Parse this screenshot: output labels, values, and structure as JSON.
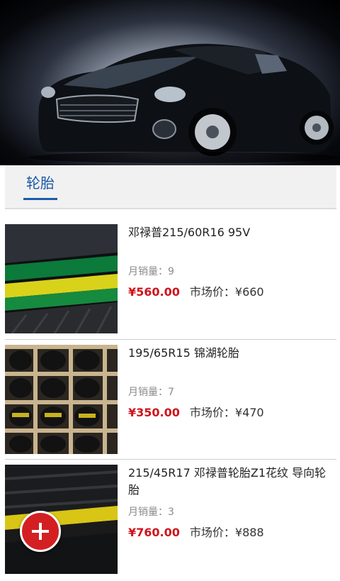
{
  "banner": {
    "image": "sports-car-photo"
  },
  "tabs": [
    {
      "label": "轮胎",
      "active": true
    }
  ],
  "products": [
    {
      "title": "邓禄普215/60R16 95V",
      "sales_label": "月销量：",
      "sales_count": "9",
      "price": "¥560.00",
      "market_label": "市场价：",
      "market_price": "¥660",
      "image": "dunlop-tire-photo"
    },
    {
      "title": "195/65R15 锦湖轮胎",
      "sales_label": "月销量：",
      "sales_count": "7",
      "price": "¥350.00",
      "market_label": "市场价：",
      "market_price": "¥470",
      "image": "tire-rack-photo"
    },
    {
      "title": "215/45R17 邓禄普轮胎Z1花纹 导向轮胎",
      "sales_label": "月销量：",
      "sales_count": "3",
      "price": "¥760.00",
      "market_label": "市场价：",
      "market_price": "¥888",
      "image": "dunlop-tire-label-photo"
    }
  ],
  "fab": {
    "icon": "plus-icon"
  },
  "colors": {
    "accent": "#1d5aa8",
    "price": "#d0131a",
    "fab": "#d41f22"
  }
}
